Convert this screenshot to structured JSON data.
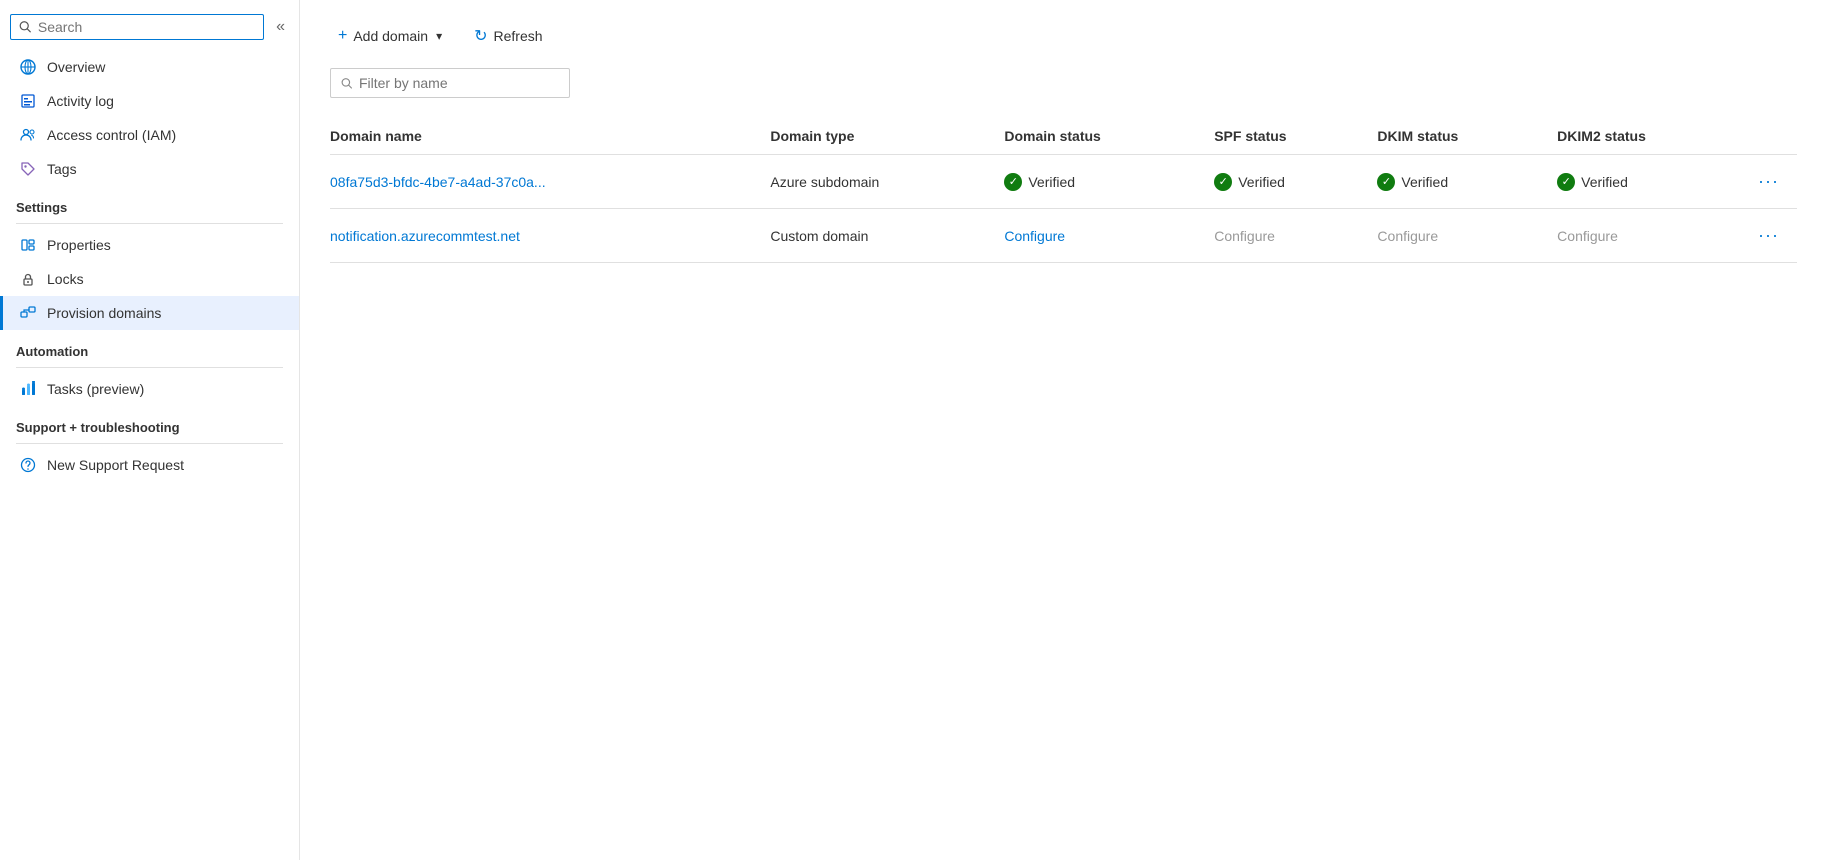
{
  "sidebar": {
    "search_placeholder": "Search",
    "collapse_label": "«",
    "nav": [
      {
        "id": "overview",
        "label": "Overview",
        "icon": "globe"
      },
      {
        "id": "activity-log",
        "label": "Activity log",
        "icon": "list"
      }
    ],
    "settings_section": "Settings",
    "settings_items": [
      {
        "id": "access-control",
        "label": "Access control (IAM)",
        "icon": "people"
      },
      {
        "id": "tags",
        "label": "Tags",
        "icon": "tag"
      },
      {
        "id": "properties",
        "label": "Properties",
        "icon": "bars"
      },
      {
        "id": "locks",
        "label": "Locks",
        "icon": "lock"
      },
      {
        "id": "provision-domains",
        "label": "Provision domains",
        "icon": "domain",
        "active": true
      }
    ],
    "automation_section": "Automation",
    "automation_items": [
      {
        "id": "tasks",
        "label": "Tasks (preview)",
        "icon": "tasks"
      }
    ],
    "support_section": "Support + troubleshooting",
    "support_items": [
      {
        "id": "new-support",
        "label": "New Support Request",
        "icon": "help"
      }
    ]
  },
  "toolbar": {
    "add_domain_label": "Add domain",
    "refresh_label": "Refresh"
  },
  "filter": {
    "placeholder": "Filter by name"
  },
  "table": {
    "columns": [
      "Domain name",
      "Domain type",
      "Domain status",
      "SPF status",
      "DKIM status",
      "DKIM2 status",
      ""
    ],
    "rows": [
      {
        "id": "row1",
        "domain_name": "08fa75d3-bfdc-4be7-a4ad-37c0a...",
        "domain_type": "Azure subdomain",
        "domain_status": "Verified",
        "domain_status_type": "verified",
        "spf_status": "Verified",
        "spf_status_type": "verified",
        "dkim_status": "Verified",
        "dkim_status_type": "verified",
        "dkim2_status": "Verified",
        "dkim2_status_type": "verified"
      },
      {
        "id": "row2",
        "domain_name": "notification.azurecommtest.net",
        "domain_type": "Custom domain",
        "domain_status": "Configure",
        "domain_status_type": "configure-link",
        "spf_status": "Configure",
        "spf_status_type": "configure-grey",
        "dkim_status": "Configure",
        "dkim_status_type": "configure-grey",
        "dkim2_status": "Configure",
        "dkim2_status_type": "configure-grey"
      }
    ]
  }
}
